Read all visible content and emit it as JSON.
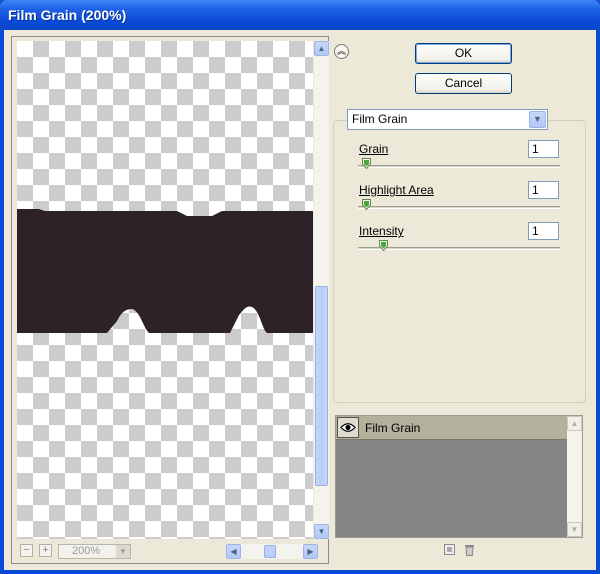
{
  "window": {
    "title": "Film Grain (200%)"
  },
  "preview": {
    "zoom_out_label": "−",
    "zoom_in_label": "+",
    "zoom_value": "200%"
  },
  "buttons": {
    "ok": "OK",
    "cancel": "Cancel"
  },
  "filter": {
    "selected": "Film Grain"
  },
  "params": [
    {
      "label": "Grain",
      "value": "1",
      "level": 1
    },
    {
      "label": "Highlight Area",
      "value": "1",
      "level": 1
    },
    {
      "label": "Intensity",
      "value": "1",
      "level": 1
    }
  ],
  "layers": {
    "items": [
      {
        "name": "Film Grain"
      }
    ]
  },
  "icons": {
    "collapse": "collapse-up-icon",
    "eye": "eye-icon",
    "new_layer": "new-effect-layer-icon",
    "delete": "trash-icon"
  },
  "colors": {
    "grain_shape": "#2c2228",
    "titlebar": "#0a4bd8",
    "dialog_bg": "#ece9d8"
  }
}
